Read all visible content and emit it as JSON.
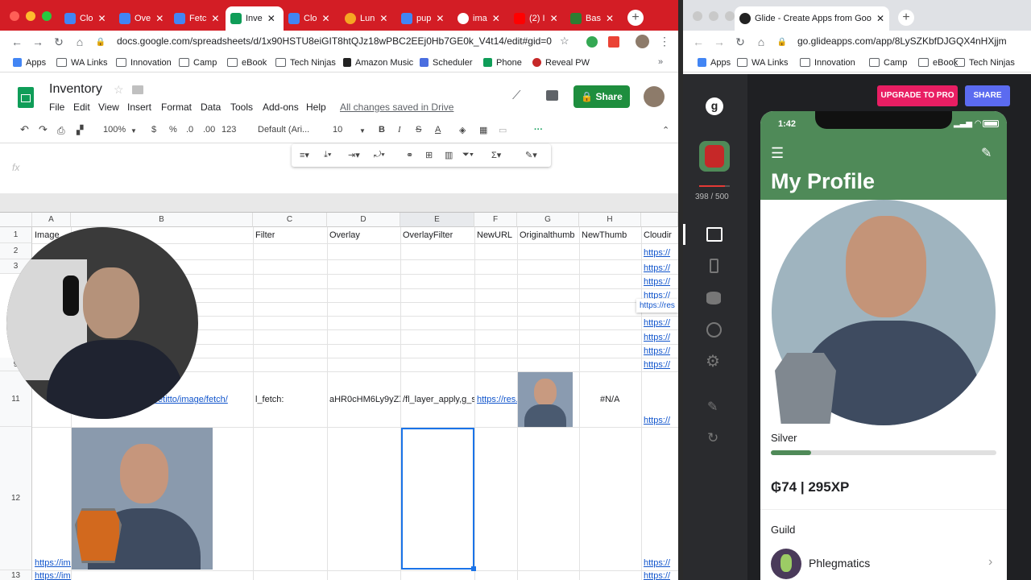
{
  "left_browser": {
    "tabs": [
      "Clo",
      "Ove",
      "Fetc",
      "Inve",
      "Clo",
      "Lun",
      "pup",
      "ima",
      "(2) I",
      "Bas"
    ],
    "active_tab": 3,
    "url": "docs.google.com/spreadsheets/d/1x90HSTU8eiGIT8htQJz18wPBC2EEj0Hb7GE0k_V4t14/edit#gid=0",
    "bookmarks": [
      "Apps",
      "WA Links",
      "Innovation",
      "Camp",
      "eBook",
      "Tech Ninjas",
      "Amazon Music",
      "Scheduler",
      "Phone",
      "Reveal PW"
    ]
  },
  "sheet": {
    "title": "Inventory",
    "menu": [
      "File",
      "Edit",
      "View",
      "Insert",
      "Format",
      "Data",
      "Tools",
      "Add-ons",
      "Help"
    ],
    "save_status": "All changes saved in Drive",
    "share_label": "Share",
    "toolbar": {
      "zoom": "100%",
      "currency": "$",
      "percent": "%",
      "dec_less": ".0",
      "dec_more": ".00",
      "format": "123",
      "font": "Default (Ari...",
      "size": "10"
    },
    "fx": "fx",
    "columns": [
      "A",
      "B",
      "C",
      "D",
      "E",
      "F",
      "G",
      "H"
    ],
    "col_I_partial": "",
    "headers": [
      "Image",
      "Filter",
      "Overlay",
      "OverlayFilter",
      "NewURL",
      "Originalthumb",
      "NewThumb",
      "Cloudir"
    ],
    "rows": [
      "1",
      "2",
      "3",
      "9",
      "10",
      "11",
      "12",
      "13"
    ],
    "row11": {
      "b": "ntts://…om/rpetitto/image/fetch/",
      "c": "l_fetch:",
      "d": "aHR0cHM6Ly9yZX",
      "e": "/fl_layer_apply,g_s",
      "f": "https://res.",
      "h": "#N/A"
    },
    "link_text": "https://",
    "res_tooltip": "https://res",
    "row12_a": "https://ima",
    "row13_a": "https://ima"
  },
  "right_browser": {
    "tab_title": "Glide - Create Apps from Google",
    "url": "go.glideapps.com/app/8LySZKbfDJGQX4nHXjjm",
    "bookmarks": [
      "Apps",
      "WA Links",
      "Innovation",
      "Camp",
      "eBook",
      "Tech Ninjas"
    ]
  },
  "glide": {
    "rows_count": "398 / 500",
    "upgrade_label": "UPGRADE TO PRO",
    "share_label": "SHARE",
    "time": "1:42",
    "screen_title": "My Profile",
    "level": "Silver",
    "level_progress": 0.18,
    "xp": "₲74 | 295XP",
    "guild_header": "Guild",
    "guild_name": "Phlegmatics",
    "accent": "#4f8a58"
  }
}
